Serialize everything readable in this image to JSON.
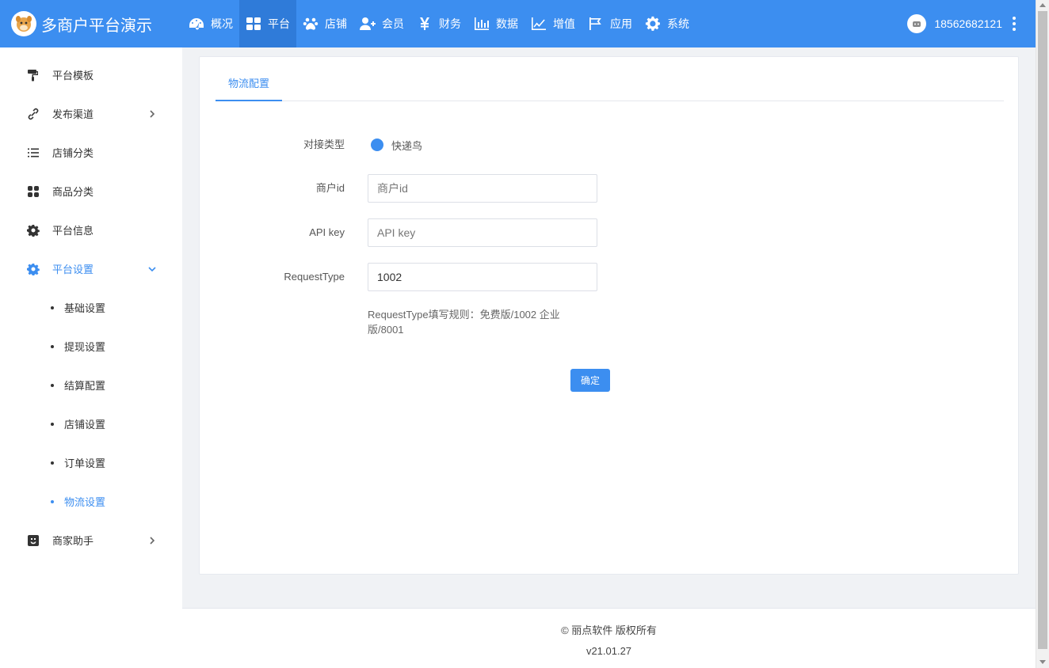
{
  "header": {
    "brand_title": "多商户平台演示",
    "nav": [
      {
        "label": "概况",
        "icon": "dashboard-icon"
      },
      {
        "label": "平台",
        "icon": "grid-icon",
        "active": true
      },
      {
        "label": "店铺",
        "icon": "paw-icon"
      },
      {
        "label": "会员",
        "icon": "user-plus-icon"
      },
      {
        "label": "财务",
        "icon": "yen-icon"
      },
      {
        "label": "数据",
        "icon": "bar-chart-icon"
      },
      {
        "label": "增值",
        "icon": "line-chart-icon"
      },
      {
        "label": "应用",
        "icon": "flag-icon"
      },
      {
        "label": "系统",
        "icon": "gear-icon"
      }
    ],
    "user_phone": "18562682121"
  },
  "sidebar": {
    "items": [
      {
        "label": "平台模板",
        "icon": "paint-roller-icon"
      },
      {
        "label": "发布渠道",
        "icon": "link-icon",
        "chevron": "right"
      },
      {
        "label": "店铺分类",
        "icon": "list-icon"
      },
      {
        "label": "商品分类",
        "icon": "apps-icon"
      },
      {
        "label": "平台信息",
        "icon": "gear-icon"
      },
      {
        "label": "平台设置",
        "icon": "settings-icon",
        "chevron": "down",
        "active": true
      },
      {
        "label": "商家助手",
        "icon": "smile-icon",
        "chevron": "right"
      }
    ],
    "sub_items": [
      {
        "label": "基础设置"
      },
      {
        "label": "提现设置"
      },
      {
        "label": "结算配置"
      },
      {
        "label": "店铺设置"
      },
      {
        "label": "订单设置"
      },
      {
        "label": "物流设置",
        "active": true
      }
    ]
  },
  "main": {
    "tab_label": "物流配置",
    "form": {
      "type_label": "对接类型",
      "type_option": "快递鸟",
      "merchant_id_label": "商户id",
      "merchant_id_placeholder": "商户id",
      "api_key_label": "API key",
      "api_key_placeholder": "API key",
      "request_type_label": "RequestType",
      "request_type_value": "1002",
      "help_text": "RequestType填写规则：免费版/1002 企业版/8001",
      "submit_label": "确定"
    }
  },
  "footer": {
    "copyright": "© 丽点软件 版权所有",
    "version": "v21.01.27"
  },
  "colors": {
    "primary": "#3c8ef0"
  }
}
